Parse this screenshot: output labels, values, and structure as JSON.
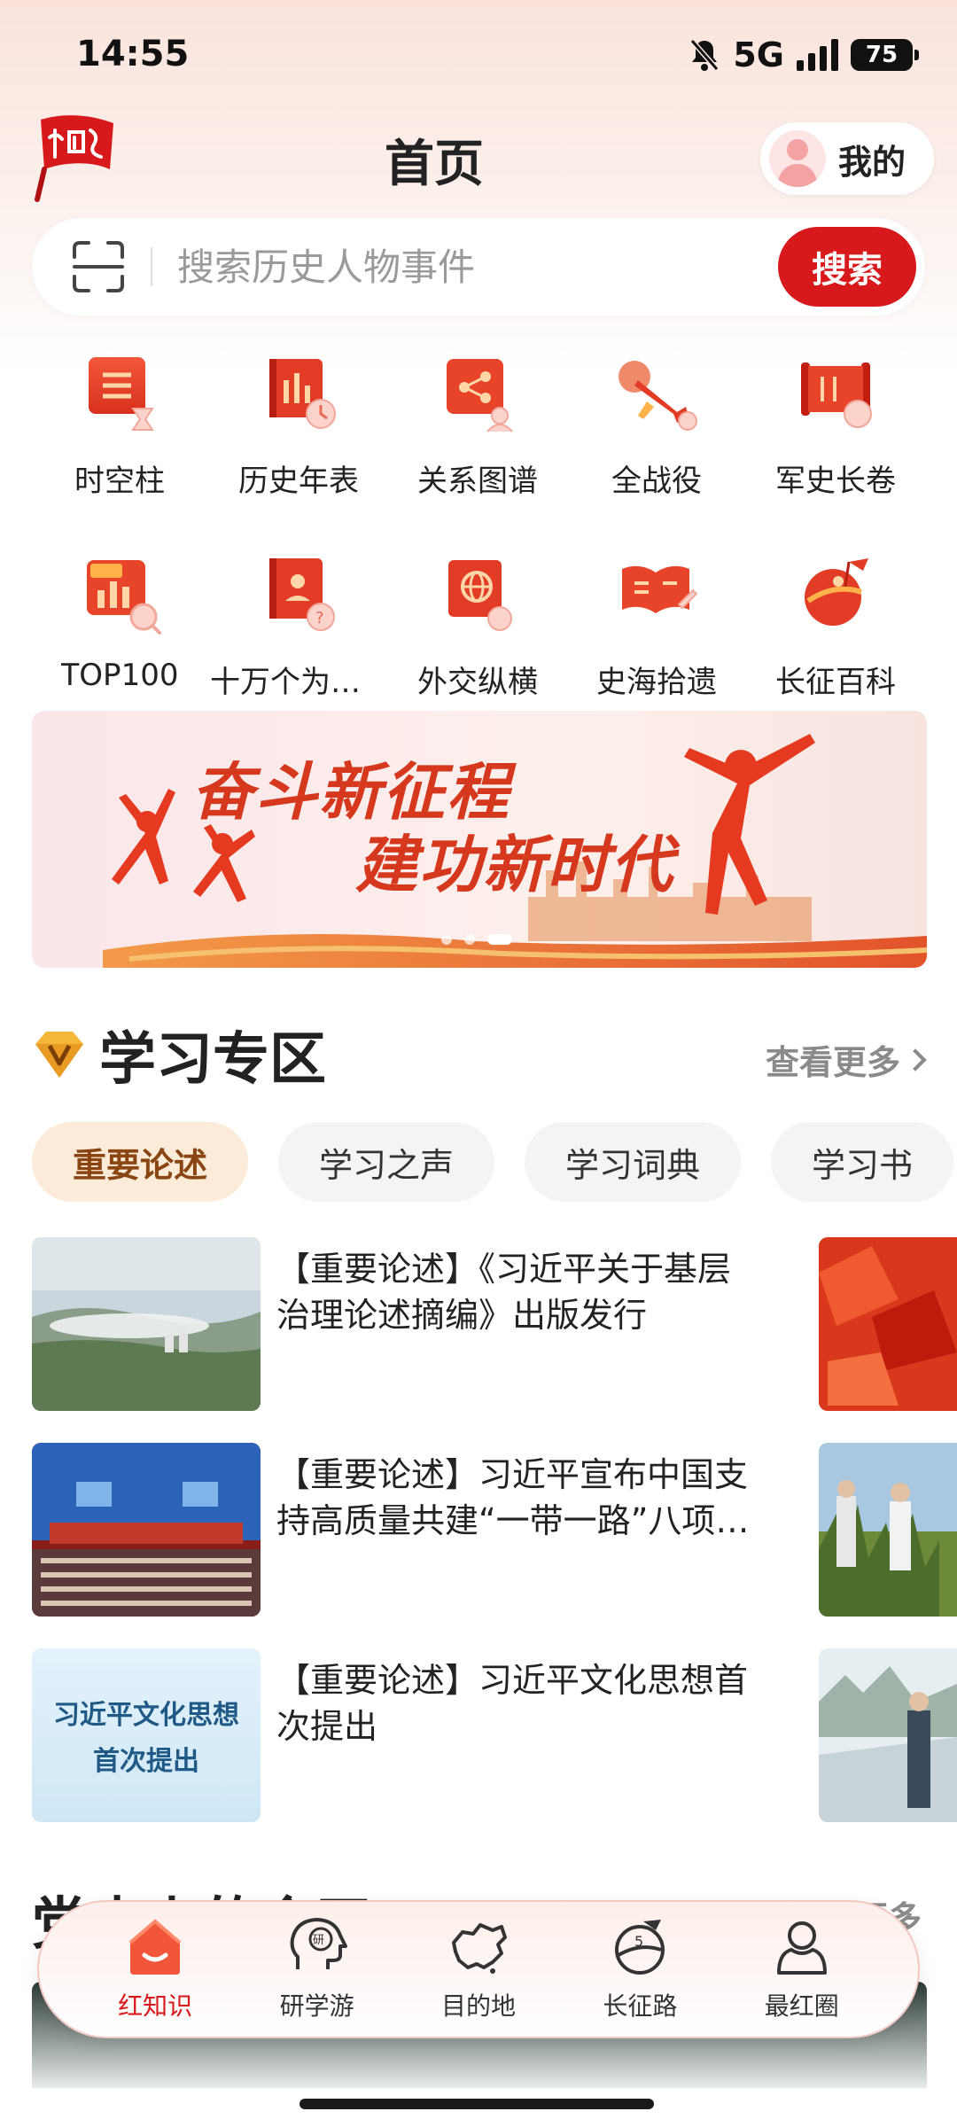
{
  "status_bar": {
    "time": "14:55",
    "network": "5G",
    "battery": "75"
  },
  "header": {
    "title": "首页",
    "mine_label": "我的"
  },
  "search": {
    "placeholder": "搜索历史人物事件",
    "button_label": "搜索"
  },
  "grid": [
    {
      "label": "时空柱",
      "icon": "timeline-pillar-icon"
    },
    {
      "label": "历史年表",
      "icon": "history-chart-icon"
    },
    {
      "label": "关系图谱",
      "icon": "relation-graph-icon"
    },
    {
      "label": "全战役",
      "icon": "bugle-icon"
    },
    {
      "label": "军史长卷",
      "icon": "military-scroll-icon"
    },
    {
      "label": "TOP100",
      "icon": "top100-icon"
    },
    {
      "label": "十万个为什么",
      "icon": "question-book-icon"
    },
    {
      "label": "外交纵横",
      "icon": "globe-book-icon"
    },
    {
      "label": "史海拾遗",
      "icon": "open-book-icon"
    },
    {
      "label": "长征百科",
      "icon": "long-march-icon"
    }
  ],
  "banner": {
    "line1": "奋斗新征程",
    "line2": "建功新时代"
  },
  "study_section": {
    "title": "学习专区",
    "more_label": "查看更多",
    "tabs": [
      "重要论述",
      "学习之声",
      "学习词典",
      "学习书"
    ],
    "items": [
      {
        "title": "【重要论述】《习近平关于基层治理论述摘编》出版发行"
      },
      {
        "title": "【重要论述】习近平宣布中国支持高质量共建“一带一路”八项行动"
      },
      {
        "title": "【重要论述】习近平文化思想首次提出",
        "thumb_text_1": "习近平文化思想",
        "thumb_text_2": "首次提出"
      }
    ]
  },
  "section2": {
    "title": "党史上的今天",
    "more_label": "查看更多"
  },
  "bottom_nav": [
    {
      "label": "红知识",
      "icon": "home-icon",
      "active": true
    },
    {
      "label": "研学游",
      "icon": "study-head-icon",
      "active": false
    },
    {
      "label": "目的地",
      "icon": "china-map-icon",
      "active": false
    },
    {
      "label": "长征路",
      "icon": "long-march-road-icon",
      "active": false
    },
    {
      "label": "最红圈",
      "icon": "circle-people-icon",
      "active": false
    }
  ],
  "colors": {
    "brand_red": "#d8191b",
    "tab_active_bg": "#fdebd9",
    "tab_active_text": "#8a4612"
  }
}
